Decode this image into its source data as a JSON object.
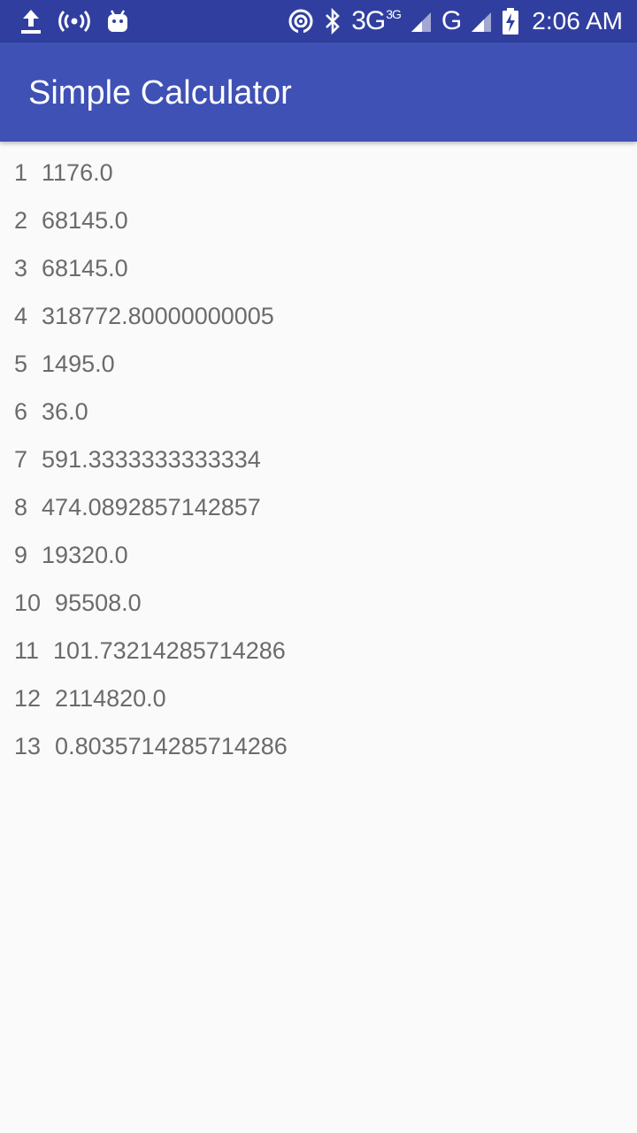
{
  "status_bar": {
    "time": "2:06 AM",
    "network_primary": "3G",
    "network_primary_sup": "3G",
    "network_secondary": "G",
    "icons": [
      "upload-icon",
      "hotspot-icon",
      "android-icon",
      "nfc-icon",
      "bluetooth-icon",
      "signal-icon",
      "signal-icon",
      "battery-charging-icon"
    ]
  },
  "app_bar": {
    "title": "Simple Calculator"
  },
  "history": [
    {
      "index": "1",
      "value": "1176.0"
    },
    {
      "index": "2",
      "value": "68145.0"
    },
    {
      "index": "3",
      "value": "68145.0"
    },
    {
      "index": "4",
      "value": "318772.80000000005"
    },
    {
      "index": "5",
      "value": "1495.0"
    },
    {
      "index": "6",
      "value": "36.0"
    },
    {
      "index": "7",
      "value": "591.3333333333334"
    },
    {
      "index": "8",
      "value": "474.0892857142857"
    },
    {
      "index": "9",
      "value": "19320.0"
    },
    {
      "index": "10",
      "value": "95508.0"
    },
    {
      "index": "11",
      "value": "101.73214285714286"
    },
    {
      "index": "12",
      "value": "2114820.0"
    },
    {
      "index": "13",
      "value": "0.8035714285714286"
    }
  ],
  "colors": {
    "status_bar": "#303f9f",
    "app_bar": "#3f51b5",
    "background": "#fafafa",
    "text": "#6b6b6b"
  }
}
